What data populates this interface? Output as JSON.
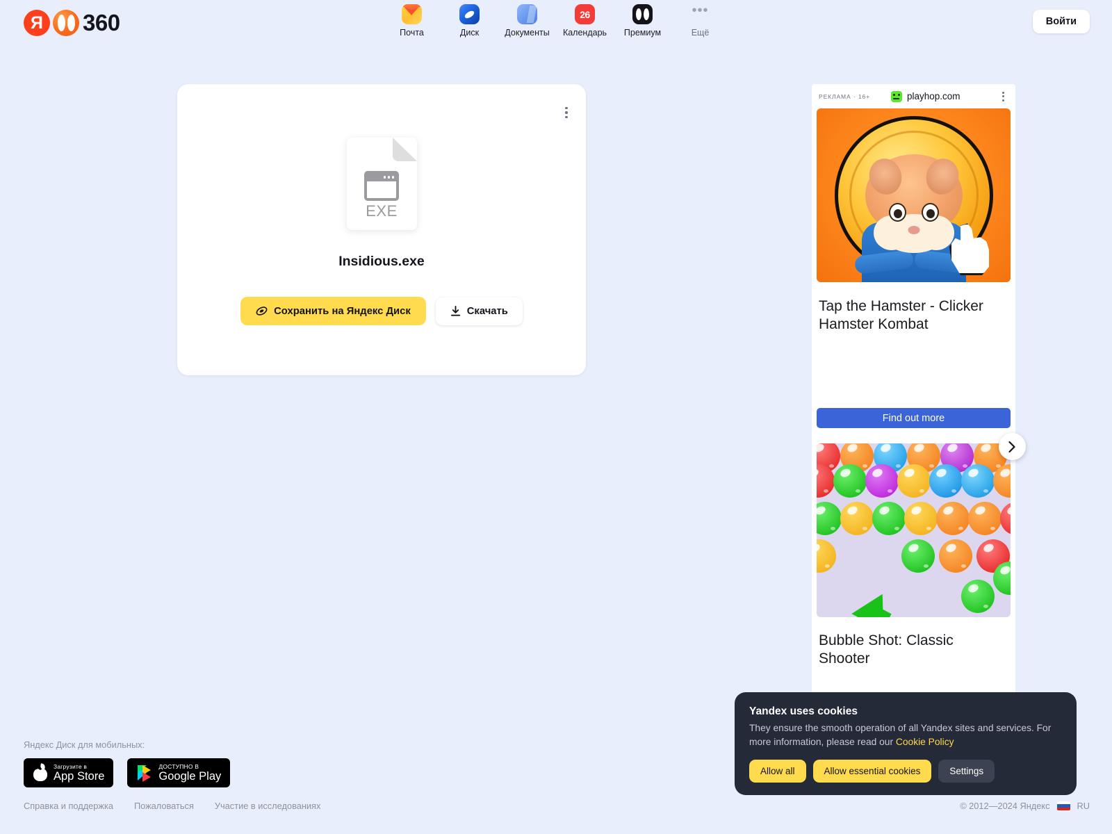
{
  "header": {
    "logo": {
      "ya_letter": "Я",
      "suffix": "360"
    },
    "nav": [
      {
        "label": "Почта",
        "icon": "mail-icon"
      },
      {
        "label": "Диск",
        "icon": "disk-icon"
      },
      {
        "label": "Документы",
        "icon": "documents-icon"
      },
      {
        "label": "Календарь",
        "icon": "calendar-icon",
        "badge": "26"
      },
      {
        "label": "Премиум",
        "icon": "premium-icon"
      },
      {
        "label": "Ещё",
        "icon": "more-dots-icon"
      }
    ],
    "login_label": "Войти"
  },
  "file_card": {
    "file_name": "Insidious.exe",
    "file_extension": "EXE",
    "save_label": "Сохранить на Яндекс Диск",
    "download_label": "Скачать"
  },
  "ad": {
    "label": "РЕКЛАМА · 16+",
    "domain": "playhop.com",
    "items": [
      {
        "title": "Tap the Hamster - Clicker Hamster Kombat",
        "cta": "Find out more"
      },
      {
        "title": "Bubble Shot: Classic Shooter"
      }
    ]
  },
  "cookie": {
    "title": "Yandex uses cookies",
    "text_before": "They ensure the smooth operation of all Yandex sites and services. For more information, please read our ",
    "link": "Cookie Policy",
    "buttons": {
      "allow_all": "Allow all",
      "allow_essential": "Allow essential cookies",
      "settings": "Settings"
    }
  },
  "footer": {
    "caption": "Яндекс Диск для мобильных:",
    "app_store": {
      "small": "Загрузите в",
      "big": "App Store"
    },
    "google_play": {
      "small": "ДОСТУПНО В",
      "big": "Google Play"
    },
    "links": [
      "Справка и поддержка",
      "Пожаловаться",
      "Участие в исследованиях"
    ],
    "copyright": "© 2012—2024 Яндекс",
    "language": "RU"
  },
  "colors": {
    "page_bg": "#e9eefc",
    "accent_yellow": "#ffdb4d",
    "yandex_red": "#fc3f1d",
    "ad_cta_blue": "#3a64d8",
    "cookie_bg": "#252a39"
  }
}
